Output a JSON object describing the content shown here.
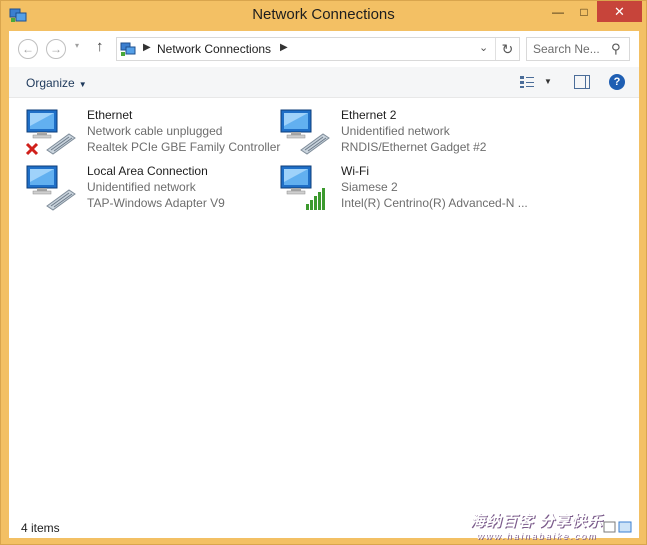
{
  "window": {
    "title": "Network Connections",
    "controls": {
      "minimize": "—",
      "maximize": "□",
      "close": "✕"
    }
  },
  "address_bar": {
    "back": "←",
    "forward": "→",
    "recent": "▾",
    "up": "↑",
    "path_separator": "▶",
    "path": "Network Connections",
    "dropdown": "⌄",
    "refresh": "↻",
    "search_placeholder": "Search Ne..."
  },
  "toolbar": {
    "organize_label": "Organize",
    "organize_caret": "▼",
    "view_caret": "▼",
    "help": "?"
  },
  "connections": [
    {
      "name": "Ethernet",
      "status": "Network cable unplugged",
      "device": "Realtek PCIe GBE Family Controller",
      "badge": "disconnected-x"
    },
    {
      "name": "Ethernet 2",
      "status": "Unidentified network",
      "device": "RNDIS/Ethernet Gadget #2",
      "badge": "none"
    },
    {
      "name": "Local Area Connection",
      "status": "Unidentified network",
      "device": "TAP-Windows Adapter V9",
      "badge": "none"
    },
    {
      "name": "Wi-Fi",
      "status": "Siamese  2",
      "device": "Intel(R) Centrino(R) Advanced-N ...",
      "badge": "signal-bars"
    }
  ],
  "status_bar": {
    "item_count": "4 items"
  },
  "watermark": {
    "text": "海纳百客 分享快乐",
    "sub": "www.hainabaike.com"
  },
  "colors": {
    "frame": "#f3c064",
    "close_button": "#c7443a",
    "link_text": "#1e395b",
    "secondary_text": "#6d6d6d",
    "signal_green": "#3c9a2e",
    "error_red": "#d0201b"
  }
}
